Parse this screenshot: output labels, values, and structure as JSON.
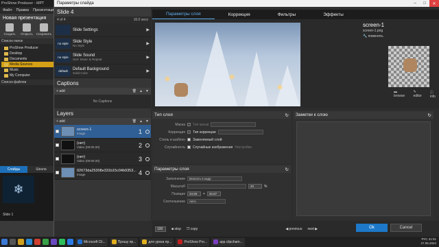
{
  "app": {
    "title": "ProShow Producer - МРТ",
    "menu": [
      "Файл",
      "Правка",
      "Презентация"
    ],
    "project_title": "Новая презентация",
    "toolbar": [
      "Создать",
      "Открыть",
      "Сохранить"
    ],
    "folder_list_label": "Список папок",
    "tree": [
      "ProShow Producer",
      "Desktop",
      "Documents",
      "Media Sources",
      "Music",
      "My Computer"
    ],
    "file_list_label": "Список файлов",
    "slides_tab": "Слайды",
    "second_tab": "Шкала",
    "slide_label": "Slide 1"
  },
  "dialog": {
    "title": "Параметры слайда",
    "slide_title": "Slide 4",
    "slide_meta_left": "4 of 4",
    "slide_meta_right": "16.0 secs",
    "settings": [
      {
        "thumb": "",
        "title": "Slide Settings",
        "sub": ""
      },
      {
        "thumb": "no style",
        "title": "Slide Style",
        "sub": "No Style"
      },
      {
        "thumb": "no style",
        "title": "Slide Sound",
        "sub": "Sort: Music & Repeat"
      },
      {
        "thumb": "default",
        "title": "Default Background",
        "sub": "Solid Color"
      }
    ],
    "captions_title": "Captions",
    "captions_add": "add",
    "captions_empty": "No Captions",
    "layers_title": "Layers",
    "layers_add": "add",
    "layers": [
      {
        "name": "screen-1",
        "sub": "Image",
        "num": "1"
      },
      {
        "name": "(нет)",
        "sub": "Video (00:00:20)",
        "num": "2"
      },
      {
        "name": "(нет)",
        "sub": "Video (00:00:20)",
        "num": "3"
      },
      {
        "name": "02673da25308e331b15c04b9353...",
        "sub": "Image",
        "num": "4"
      }
    ],
    "tabs": [
      "Параметры слоя",
      "Коррекция",
      "Фильтры",
      "Эффекты"
    ],
    "layer_name": "screen-1",
    "layer_file": "screen-1.png",
    "layer_edit": "поменять",
    "preview_buttons": [
      "browse",
      "editor",
      "info"
    ],
    "layer_type": {
      "title": "Тип слоя",
      "mask_label": "Маска",
      "mask_value": "Тип маски",
      "correction_label": "Коррекция",
      "correction_value": "Тип коррекции",
      "style_label": "Стиль и шаблон",
      "style_value": "Заменяемый слой",
      "random_label": "Случайность",
      "random_value": "Случайные изображения",
      "random_extra": "Настройки"
    },
    "notes_title": "Заметки к слою",
    "layer_params": {
      "title": "Параметры слоя",
      "fill_label": "Заполнение",
      "fill_value": "Вписать в кадр",
      "scale_label": "Масштаб",
      "scale_value": "40",
      "scale_unit": "%",
      "position_label": "Позиция",
      "pos_x": "34.69",
      "pos_y": "25.87",
      "ratio_label": "Соотношение",
      "ratio_value": "Авто"
    },
    "bottom": {
      "zoom": "100",
      "stop": "stop",
      "copy": "copy",
      "previous": "previous",
      "next": "next",
      "ok": "Ok",
      "cancel": "Cancel"
    }
  },
  "taskbar": {
    "apps": [
      "Microsoft Cli...",
      "Прошу пр...",
      "для урока пр...",
      "ProShow Pro...",
      "app.clipcham..."
    ],
    "time": "21:01",
    "date": "27.05.2024",
    "lang": "РУС"
  }
}
